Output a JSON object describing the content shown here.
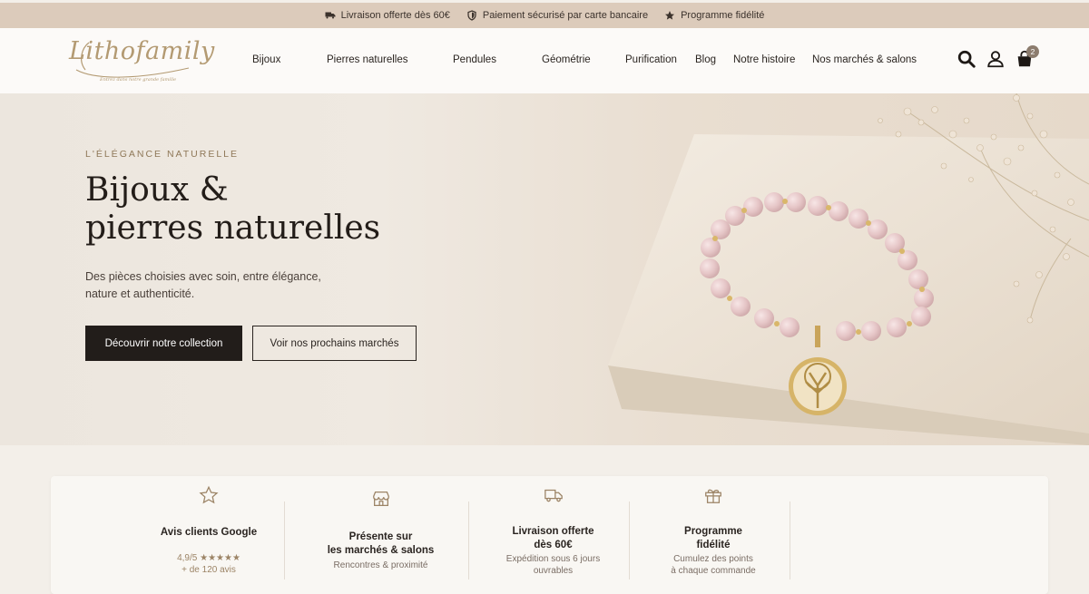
{
  "topbar": {
    "perks": [
      {
        "icon": "truck-icon",
        "label": "Livraison offerte dès 60€"
      },
      {
        "icon": "shield-icon",
        "label": "Paiement sécurisé par carte bancaire"
      },
      {
        "icon": "star-icon",
        "label": "Programme fidélité"
      }
    ]
  },
  "header": {
    "logo_text": "Lithofamily",
    "logo_tagline": "Entrez dans notre grande famille",
    "nav": [
      "Bijoux",
      "Pierres naturelles",
      "Pendules",
      "Géométrie",
      "Purification",
      "Blog",
      "Notre histoire",
      "Nos marchés & salons"
    ],
    "cart_count": "2"
  },
  "hero": {
    "eyebrow": "L'ÉLÉGANCE NATURELLE",
    "title_line1": "Bijoux &",
    "title_line2": "pierres naturelles",
    "lead": "Des pièces choisies avec soin, entre élégance, nature et authenticité.",
    "primary_button": "Découvrir notre collection",
    "secondary_button": "Voir nos prochains marchés"
  },
  "features": [
    {
      "icon": "star-icon",
      "title_line1": "Avis clients Google",
      "title_line2": "",
      "sub_line1": "4,9/5 ★★★★★",
      "sub_line2": "+ de 120 avis"
    },
    {
      "icon": "store-icon",
      "title_line1": "Présente sur",
      "title_line2": "les marchés & salons",
      "sub_line1": "Rencontres & proximité",
      "sub_line2": ""
    },
    {
      "icon": "truck-icon",
      "title_line1": "Livraison offerte",
      "title_line2": "dès 60€",
      "sub_line1": "Expédition sous 6 jours",
      "sub_line2": "ouvrables"
    },
    {
      "icon": "gift-icon",
      "title_line1": "Programme",
      "title_line2": "fidélité",
      "sub_line1": "Cumulez des points",
      "sub_line2": "à chaque commande"
    }
  ],
  "colors": {
    "topbar_bg": "#dccbbb",
    "accent_gold": "#b39a72",
    "dark_button": "#221d1a",
    "hero_bg": "#ece6de"
  }
}
